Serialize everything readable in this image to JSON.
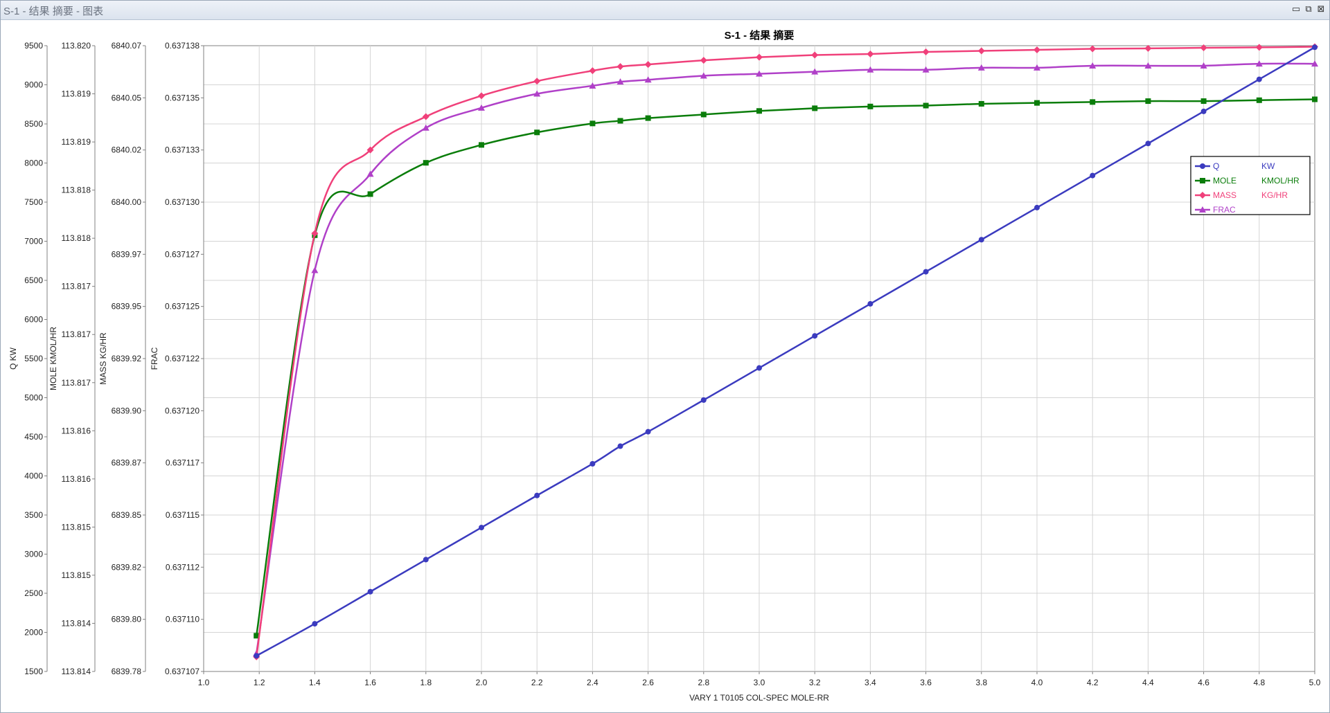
{
  "window": {
    "title": "S-1 - 结果 摘要 - 图表",
    "controls": [
      "▭",
      "⧉",
      "⊠"
    ]
  },
  "chart_data": {
    "type": "line",
    "title": "S-1 - 结果 摘要",
    "xlabel": "VARY   1 T0105    COL-SPEC MOLE-RR",
    "xlim": [
      1.0,
      5.0
    ],
    "xticks": [
      "1.0",
      "1.2",
      "1.4",
      "1.6",
      "1.8",
      "2.0",
      "2.2",
      "2.4",
      "2.6",
      "2.8",
      "3.0",
      "3.2",
      "3.4",
      "3.6",
      "3.8",
      "4.0",
      "4.2",
      "4.4",
      "4.6",
      "4.8",
      "5.0"
    ],
    "grid": true,
    "legend_position": "right",
    "axes": [
      {
        "key": "q",
        "name": "Q",
        "unit": "KW",
        "ylim": [
          1500,
          9500
        ],
        "ticks": [
          "1500",
          "2000",
          "2500",
          "3000",
          "3500",
          "4000",
          "4500",
          "5000",
          "5500",
          "6000",
          "6500",
          "7000",
          "7500",
          "8000",
          "8500",
          "9000",
          "9500"
        ]
      },
      {
        "key": "mole",
        "name": "MOLE",
        "unit": "KMOL/HR",
        "ylim": [
          113.8135,
          113.8205
        ],
        "ticks": [
          "113.814",
          "113.814",
          "113.815",
          "113.815",
          "113.816",
          "113.816",
          "113.817",
          "113.817",
          "113.817",
          "113.818",
          "113.818",
          "113.819",
          "113.819",
          "113.820"
        ]
      },
      {
        "key": "mass",
        "name": "MASS",
        "unit": "KG/HR",
        "ylim": [
          6839.775,
          6840.075
        ],
        "ticks": [
          "6839.78",
          "6839.80",
          "6839.82",
          "6839.85",
          "6839.87",
          "6839.90",
          "6839.92",
          "6839.95",
          "6839.97",
          "6840.00",
          "6840.02",
          "6840.05",
          "6840.07"
        ]
      },
      {
        "key": "frac",
        "name": "FRAC",
        "unit": "",
        "ylim": [
          0.637107,
          0.6371382
        ],
        "ticks": [
          "0.637107",
          "0.637110",
          "0.637112",
          "0.637115",
          "0.637117",
          "0.637120",
          "0.637122",
          "0.637125",
          "0.637127",
          "0.637130",
          "0.637133",
          "0.637135",
          "0.637138"
        ]
      }
    ],
    "x": [
      1.19,
      1.4,
      1.6,
      1.8,
      2.0,
      2.2,
      2.4,
      2.5,
      2.6,
      2.8,
      3.0,
      3.2,
      3.4,
      3.6,
      3.8,
      4.0,
      4.2,
      4.4,
      4.6,
      4.8,
      5.0
    ],
    "series": [
      {
        "name": "Q",
        "unit": "KW",
        "axis": 0,
        "color": "#3b3bbf",
        "marker": "circle",
        "values": [
          1700,
          2110,
          2520,
          2930,
          3340,
          3750,
          4155,
          4380,
          4565,
          4970,
          5380,
          5790,
          6200,
          6610,
          7020,
          7430,
          7840,
          8250,
          8660,
          9070,
          9480
        ]
      },
      {
        "name": "MOLE",
        "unit": "KMOL/HR",
        "axis": 1,
        "color": "#0a7d0a",
        "marker": "square",
        "values": [
          113.8139,
          113.81838,
          113.81884,
          113.81919,
          113.81939,
          113.81953,
          113.81963,
          113.81966,
          113.81969,
          113.81973,
          113.81977,
          113.8198,
          113.81982,
          113.81983,
          113.81985,
          113.81986,
          113.81987,
          113.81988,
          113.81988,
          113.81989,
          113.8199
        ]
      },
      {
        "name": "MASS",
        "unit": "KG/HR",
        "axis": 2,
        "color": "#f0407a",
        "marker": "diamond",
        "values": [
          6839.782,
          6839.985,
          6840.025,
          6840.041,
          6840.051,
          6840.058,
          6840.063,
          6840.065,
          6840.066,
          6840.068,
          6840.0695,
          6840.0705,
          6840.071,
          6840.072,
          6840.0725,
          6840.073,
          6840.0735,
          6840.0737,
          6840.074,
          6840.0742,
          6840.0745
        ]
      },
      {
        "name": "FRAC",
        "unit": "",
        "axis": 3,
        "color": "#b040c8",
        "marker": "triangle",
        "values": [
          0.6371079,
          0.637127,
          0.6371318,
          0.6371341,
          0.6371351,
          0.6371358,
          0.6371362,
          0.6371364,
          0.6371365,
          0.6371367,
          0.6371368,
          0.6371369,
          0.637137,
          0.637137,
          0.6371371,
          0.6371371,
          0.6371372,
          0.6371372,
          0.6371372,
          0.6371373,
          0.6371373
        ]
      }
    ]
  }
}
